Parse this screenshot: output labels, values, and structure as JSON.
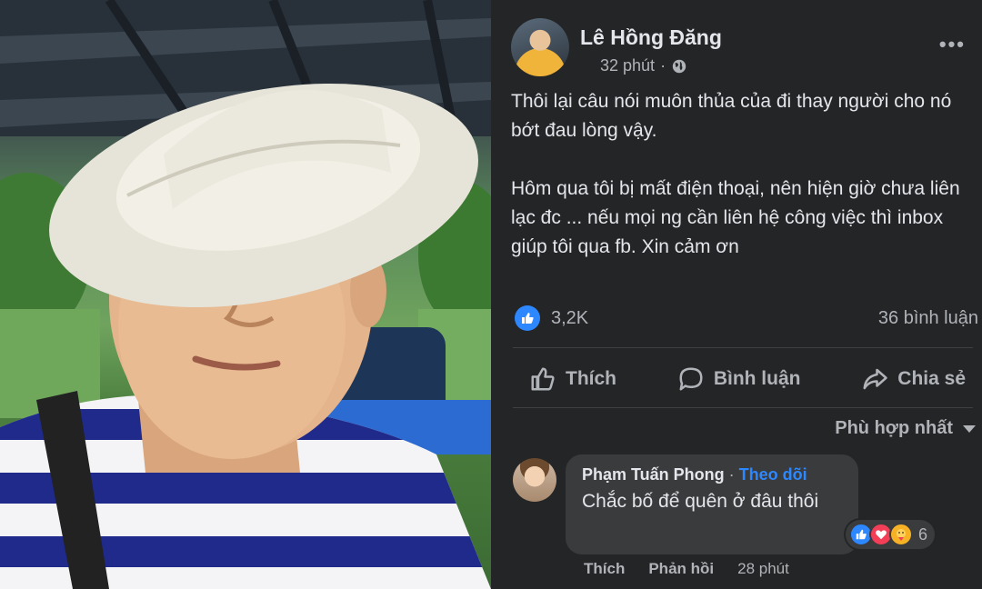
{
  "post": {
    "author": "Lê Hồng Đăng",
    "time": "32 phút",
    "body_paragraphs": [
      "Thôi lại câu nói muôn thủa của đi thay người cho nó bớt đau lòng vậy.",
      "Hôm qua tôi bị mất điện thoại, nên hiện giờ chưa liên lạc đc ... nếu mọi ng cần liên hệ công việc thì inbox giúp tôi qua fb. Xin cảm ơn"
    ],
    "reaction_count": "3,2K",
    "comment_count": "36 bình luận",
    "more_label": "•••"
  },
  "actions": {
    "like": "Thích",
    "comment": "Bình luận",
    "share": "Chia sẻ"
  },
  "sort": {
    "label": "Phù hợp nhất"
  },
  "comment": {
    "author": "Phạm Tuấn Phong",
    "separator": " · ",
    "follow": "Theo dõi",
    "text": "Chắc bố để quên ở đâu thôi",
    "reaction_count": "6",
    "like_label": "Thích",
    "reply_label": "Phản hồi",
    "time": "28 phút"
  },
  "colors": {
    "panel_bg": "#242526",
    "accent_blue": "#2d88ff",
    "love_red": "#f33e58",
    "care_yellow": "#f7b125"
  }
}
